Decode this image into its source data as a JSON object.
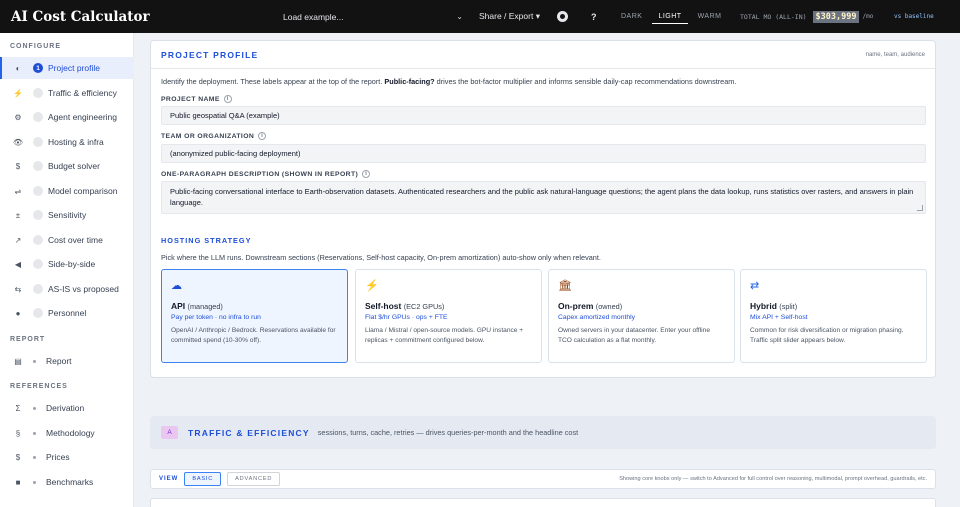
{
  "header": {
    "logo": "AI Cost Calculator",
    "load_example": "Load example...",
    "share": "Share / Export",
    "help": "?",
    "themes": [
      "DARK",
      "LIGHT",
      "WARM"
    ],
    "active_theme": "LIGHT",
    "total_label": "TOTAL MO (ALL-IN)",
    "total_value": "$303,999",
    "total_unit": "/mo",
    "baseline_link": "vs baseline"
  },
  "sidebar": {
    "configure_title": "CONFIGURE",
    "configure_items": [
      {
        "icon": "◐",
        "label": "Project profile",
        "num": "1"
      },
      {
        "icon": "⚡",
        "label": "Traffic & efficiency"
      },
      {
        "icon": "⚙",
        "label": "Agent engineering"
      },
      {
        "icon": "👁",
        "label": "Hosting & infra"
      },
      {
        "icon": "$",
        "label": "Budget solver"
      },
      {
        "icon": "⇌",
        "label": "Model comparison"
      },
      {
        "icon": "±",
        "label": "Sensitivity"
      },
      {
        "icon": "↗",
        "label": "Cost over time"
      },
      {
        "icon": "◀",
        "label": "Side-by-side"
      },
      {
        "icon": "⇆",
        "label": "AS-IS vs proposed"
      },
      {
        "icon": "●",
        "label": "Personnel"
      }
    ],
    "report_title": "REPORT",
    "report_items": [
      {
        "icon": "▤",
        "label": "Report"
      }
    ],
    "references_title": "REFERENCES",
    "reference_items": [
      {
        "icon": "Σ",
        "label": "Derivation"
      },
      {
        "icon": "§",
        "label": "Methodology"
      },
      {
        "icon": "$",
        "label": "Prices"
      },
      {
        "icon": "■",
        "label": "Benchmarks"
      }
    ]
  },
  "profile": {
    "title": "PROJECT PROFILE",
    "hint": "name, team, audience",
    "intro_pre": "Identify the deployment. These labels appear at the top of the report. ",
    "intro_bold": "Public-facing?",
    "intro_post": " drives the bot-factor multiplier and informs sensible daily-cap recommendations downstream.",
    "project_name_label": "PROJECT NAME",
    "project_name_value": "Public geospatial Q&A (example)",
    "team_label": "TEAM OR ORGANIZATION",
    "team_value": "(anonymized public-facing deployment)",
    "description_label": "ONE-PARAGRAPH DESCRIPTION (SHOWN IN REPORT)",
    "description_value": "Public-facing conversational interface to Earth-observation datasets. Authenticated researchers and the public ask natural-language questions; the agent plans the data lookup, runs statistics over rasters, and answers in plain language.",
    "hosting_title": "HOSTING STRATEGY",
    "hosting_desc": "Pick where the LLM runs. Downstream sections (Reservations, Self-host capacity, On-prem amortization) auto-show only when relevant.",
    "options": [
      {
        "icon": "☁",
        "title": "API",
        "title_note": "(managed)",
        "sub": "Pay per token · no infra to run",
        "desc": "OpenAI / Anthropic / Bedrock. Reservations available for committed spend (10-30% off)."
      },
      {
        "icon": "⚡",
        "title": "Self-host",
        "title_note": "(EC2 GPUs)",
        "sub": "Flat $/hr GPUs · ops + FTE",
        "desc": "Llama / Mistral / open-source models. GPU instance + replicas + commitment configured below."
      },
      {
        "icon": "🏛",
        "title": "On-prem",
        "title_note": "(owned)",
        "sub": "Capex amortized monthly",
        "desc": "Owned servers in your datacenter. Enter your offline TCO calculation as a flat monthly."
      },
      {
        "icon": "⇄",
        "title": "Hybrid",
        "title_note": "(split)",
        "sub": "Mix API + Self-host",
        "desc": "Common for risk diversification or migration phasing. Traffic split slider appears below."
      }
    ]
  },
  "traffic": {
    "badge": "A",
    "title": "TRAFFIC & EFFICIENCY",
    "desc": "sessions, turns, cache, retries — drives queries-per-month and the headline cost"
  },
  "viewbar": {
    "label": "VIEW",
    "basic": "BASIC",
    "advanced": "ADVANCED",
    "hint": "Showing core knobs only — switch to Advanced for full control over reasoning, multimodal, prompt overhead, guardrails, etc."
  }
}
